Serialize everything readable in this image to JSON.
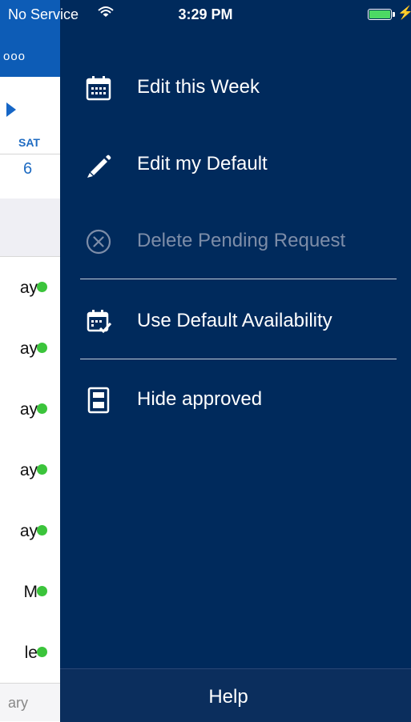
{
  "status_bar": {
    "carrier": "No Service",
    "time": "3:29 PM",
    "battery_level": 1.0,
    "charging_icon": "bolt-icon",
    "colors": {
      "battery_fill": "#4cd964"
    }
  },
  "background_screen": {
    "header_fragment": "ooo",
    "nav_icon": "play-arrow-icon",
    "day_name": "SAT",
    "day_number": "6",
    "rows": [
      {
        "text_fragment": "ay",
        "status": "green"
      },
      {
        "text_fragment": "ay",
        "status": "green"
      },
      {
        "text_fragment": "ay",
        "status": "green"
      },
      {
        "text_fragment": "ay",
        "status": "green"
      },
      {
        "text_fragment": "ay",
        "status": "green"
      },
      {
        "text_fragment": "M",
        "status": "green"
      },
      {
        "text_fragment": "le",
        "status": "green"
      }
    ],
    "footer_fragment": "ary",
    "colors": {
      "header": "#0d5cb6",
      "accent": "#1e6bc2",
      "status_green": "#3bc43b"
    }
  },
  "menu": {
    "items": [
      {
        "label": "Edit this Week",
        "icon": "calendar-icon",
        "enabled": true
      },
      {
        "label": "Edit my Default",
        "icon": "pencil-icon",
        "enabled": true
      },
      {
        "label": "Delete Pending Request",
        "icon": "circle-x-icon",
        "enabled": false
      },
      {
        "label": "Use Default Availability",
        "icon": "calendar-check-icon",
        "enabled": true
      },
      {
        "label": "Hide approved",
        "icon": "layout-blocks-icon",
        "enabled": true
      }
    ],
    "help_label": "Help",
    "colors": {
      "background": "#002a5c",
      "disabled_text": "#7d8da8",
      "help_bar": "#0b2e5d"
    }
  }
}
